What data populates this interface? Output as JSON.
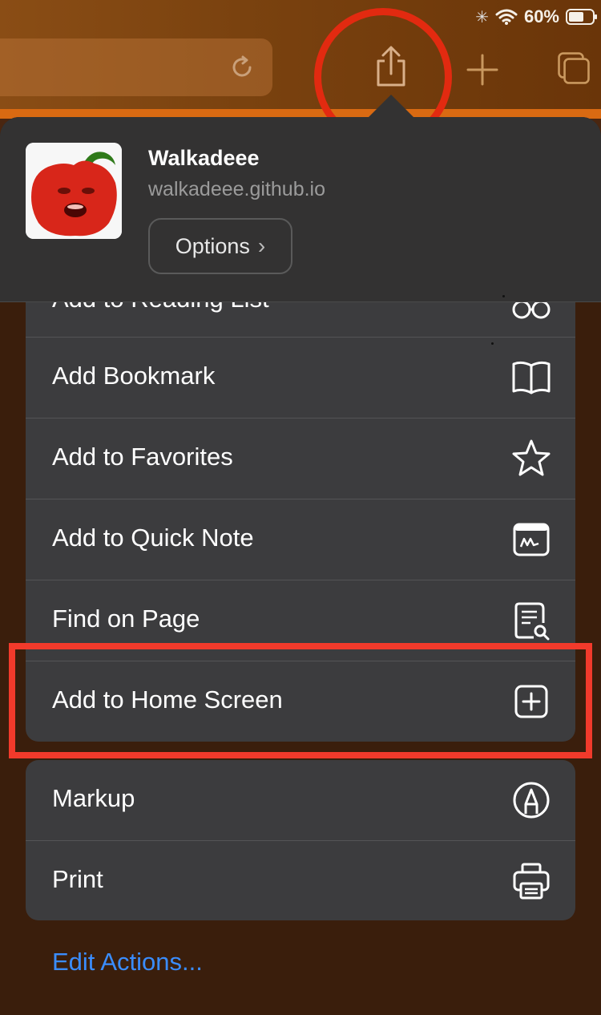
{
  "status_bar": {
    "battery_percent": "60%"
  },
  "toolbar": {
    "reload_icon": "reload-icon",
    "share_icon": "share-icon",
    "new_tab_icon": "plus-icon",
    "tabs_icon": "tabs-icon"
  },
  "share_sheet": {
    "site_title": "Walkadeee",
    "site_url": "walkadeee.github.io",
    "options_label": "Options",
    "actions_group1": [
      {
        "label": "Add to Reading List",
        "icon": "glasses-icon"
      },
      {
        "label": "Add Bookmark",
        "icon": "book-icon"
      },
      {
        "label": "Add to Favorites",
        "icon": "star-icon"
      },
      {
        "label": "Add to Quick Note",
        "icon": "quick-note-icon"
      },
      {
        "label": "Find on Page",
        "icon": "find-on-page-icon"
      },
      {
        "label": "Add to Home Screen",
        "icon": "plus-square-icon"
      }
    ],
    "actions_group2": [
      {
        "label": "Markup",
        "icon": "markup-pen-icon"
      },
      {
        "label": "Print",
        "icon": "printer-icon"
      }
    ],
    "edit_actions_label": "Edit Actions..."
  },
  "annotations": {
    "circle_color": "#e22a10",
    "highlight_color": "#f23a2b"
  }
}
